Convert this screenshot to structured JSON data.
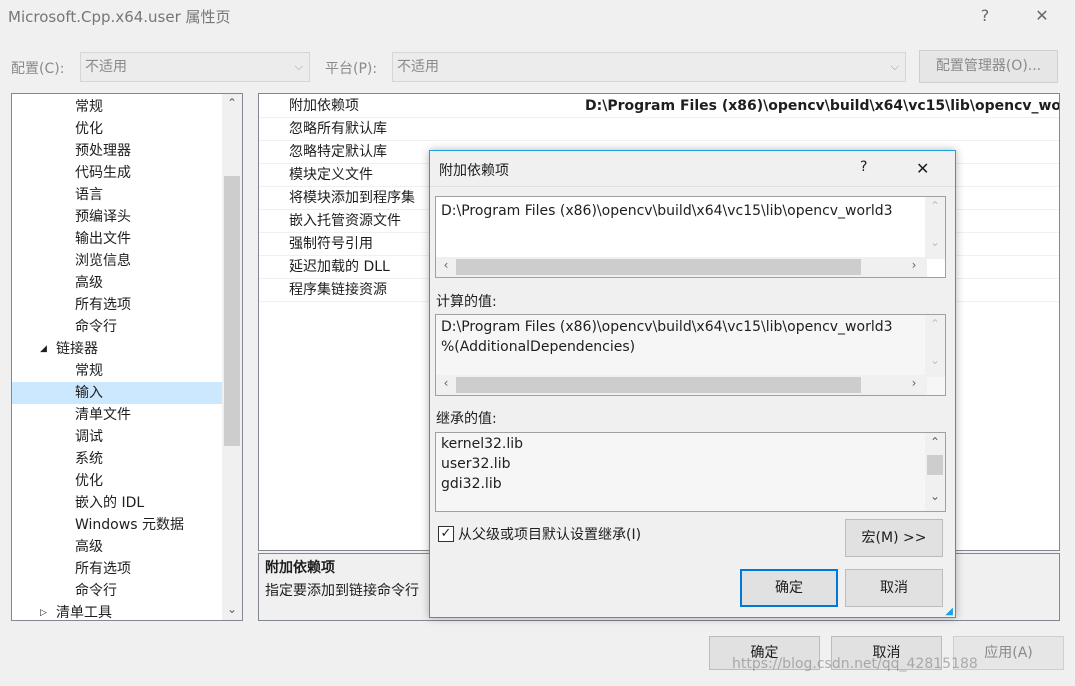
{
  "window": {
    "title": "Microsoft.Cpp.x64.user 属性页",
    "help_glyph": "?",
    "close_glyph": "✕"
  },
  "toolbar": {
    "config_label": "配置(C):",
    "config_value": "不适用",
    "platform_label": "平台(P):",
    "platform_value": "不适用",
    "config_manager_label": "配置管理器(O)..."
  },
  "tree": {
    "items": [
      {
        "label": "常规"
      },
      {
        "label": "优化"
      },
      {
        "label": "预处理器"
      },
      {
        "label": "代码生成"
      },
      {
        "label": "语言"
      },
      {
        "label": "预编译头"
      },
      {
        "label": "输出文件"
      },
      {
        "label": "浏览信息"
      },
      {
        "label": "高级"
      },
      {
        "label": "所有选项"
      },
      {
        "label": "命令行"
      },
      {
        "label": "链接器"
      },
      {
        "label": "常规"
      },
      {
        "label": "输入"
      },
      {
        "label": "清单文件"
      },
      {
        "label": "调试"
      },
      {
        "label": "系统"
      },
      {
        "label": "优化"
      },
      {
        "label": "嵌入的 IDL"
      },
      {
        "label": "Windows 元数据"
      },
      {
        "label": "高级"
      },
      {
        "label": "所有选项"
      },
      {
        "label": "命令行"
      },
      {
        "label": "清单工具"
      }
    ]
  },
  "properties": {
    "rows": [
      {
        "name": "附加依赖项",
        "value": "D:\\Program Files (x86)\\opencv\\build\\x64\\vc15\\lib\\opencv_wor"
      },
      {
        "name": "忽略所有默认库",
        "value": ""
      },
      {
        "name": "忽略特定默认库",
        "value": ""
      },
      {
        "name": "模块定义文件",
        "value": ""
      },
      {
        "name": "将模块添加到程序集",
        "value": ""
      },
      {
        "name": "嵌入托管资源文件",
        "value": ""
      },
      {
        "name": "强制符号引用",
        "value": ""
      },
      {
        "name": "延迟加载的 DLL",
        "value": ""
      },
      {
        "name": "程序集链接资源",
        "value": ""
      }
    ]
  },
  "description": {
    "title": "附加依赖项",
    "text": "指定要添加到链接命令行"
  },
  "dialog": {
    "title": "附加依赖项",
    "help_glyph": "?",
    "close_glyph": "✕",
    "edit_value": "D:\\Program Files (x86)\\opencv\\build\\x64\\vc15\\lib\\opencv_world3",
    "computed_label": "计算的值:",
    "computed_lines": [
      "D:\\Program Files (x86)\\opencv\\build\\x64\\vc15\\lib\\opencv_world3",
      "%(AdditionalDependencies)"
    ],
    "inherited_label": "继承的值:",
    "inherited_lines": [
      "kernel32.lib",
      "user32.lib",
      "gdi32.lib"
    ],
    "inherit_checkbox_label": "从父级或项目默认设置继承(I)",
    "inherit_checked": true,
    "macro_button_label": "宏(M) >>",
    "ok_label": "确定",
    "cancel_label": "取消"
  },
  "footer": {
    "ok_label": "确定",
    "cancel_label": "取消",
    "apply_label": "应用(A)"
  },
  "watermark": "https://blog.csdn.net/qq_42815188"
}
